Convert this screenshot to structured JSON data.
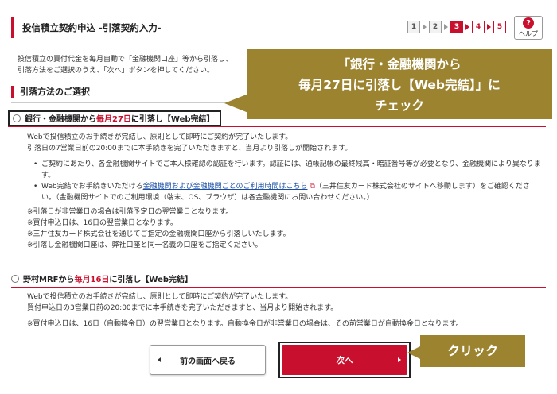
{
  "header": {
    "title": "投信積立契約申込 -引落契約入力-",
    "steps": [
      "1",
      "2",
      "3",
      "4",
      "5"
    ],
    "current_step": 3,
    "help_label": "ヘルプ"
  },
  "intro": {
    "line1": "投信積立の買付代金を毎月自動で「金融機関口座」等から引落し、",
    "line2": "引落方法をご選択のうえ、「次へ」ボタンを押してください。"
  },
  "section": {
    "title": "引落方法のご選択"
  },
  "option1": {
    "label_pre": "銀行・金融機関から",
    "label_red": "毎月27日",
    "label_post": "に引落し【Web完結】",
    "p1": "Webで投信積立のお手続きが完結し、原則として即時にご契約が完了いたします。",
    "p2": "引落日の7営業日前の20:00までに本手続きを完了いただきますと、当月より引落しが開始されます。",
    "bullet1": "ご契約にあたり、各金融機関サイトでご本人様確認の認証を行います。認証には、通帳記帳の最終残高・暗証番号等が必要となり、金融機関により異なります。",
    "bullet2_pre": "Web完結でお手続きいただける",
    "bullet2_link": "金融機関および金融機関ごとのご利用時間はこちら",
    "bullet2_post": "（三井住友カード株式会社のサイトへ移動します）をご確認ください。（金融機関サイトでのご利用環境（端末、OS、ブラウザ）は各金融機関にお問い合わせください。）",
    "note1": "※引落日が非営業日の場合は引落予定日の翌営業日となります。",
    "note2": "※買付申込日は、16日の翌営業日となります。",
    "note3": "※三井住友カード株式会社を通じてご指定の金融機関口座から引落しいたします。",
    "note4": "※引落し金融機関口座は、弊社口座と同一名義の口座をご指定ください。"
  },
  "option2": {
    "label_pre": "野村MRFから",
    "label_red": "毎月16日",
    "label_post": "に引落し【Web完結】",
    "p1": "Webで投信積立のお手続きが完結し、原則として即時にご契約が完了いたします。",
    "p2": "買付申込日の3営業日前の20:00までに本手続きを完了いただきますと、当月より開始されます。",
    "note1": "※買付申込日は、16日（自動換金日）の翌営業日となります。自動換金日が非営業日の場合は、その前営業日が自動換金日となります。"
  },
  "buttons": {
    "back": "前の画面へ戻る",
    "next": "次へ"
  },
  "annotations": {
    "callout_select_l1": "「銀行・金融機関から",
    "callout_select_l2": "毎月27日に引落し【Web完結】」に",
    "callout_select_l3": "チェック",
    "callout_click": "クリック"
  },
  "colors": {
    "accent": "#c8102e",
    "callout": "#9c8330",
    "link": "#1a4ea5"
  }
}
